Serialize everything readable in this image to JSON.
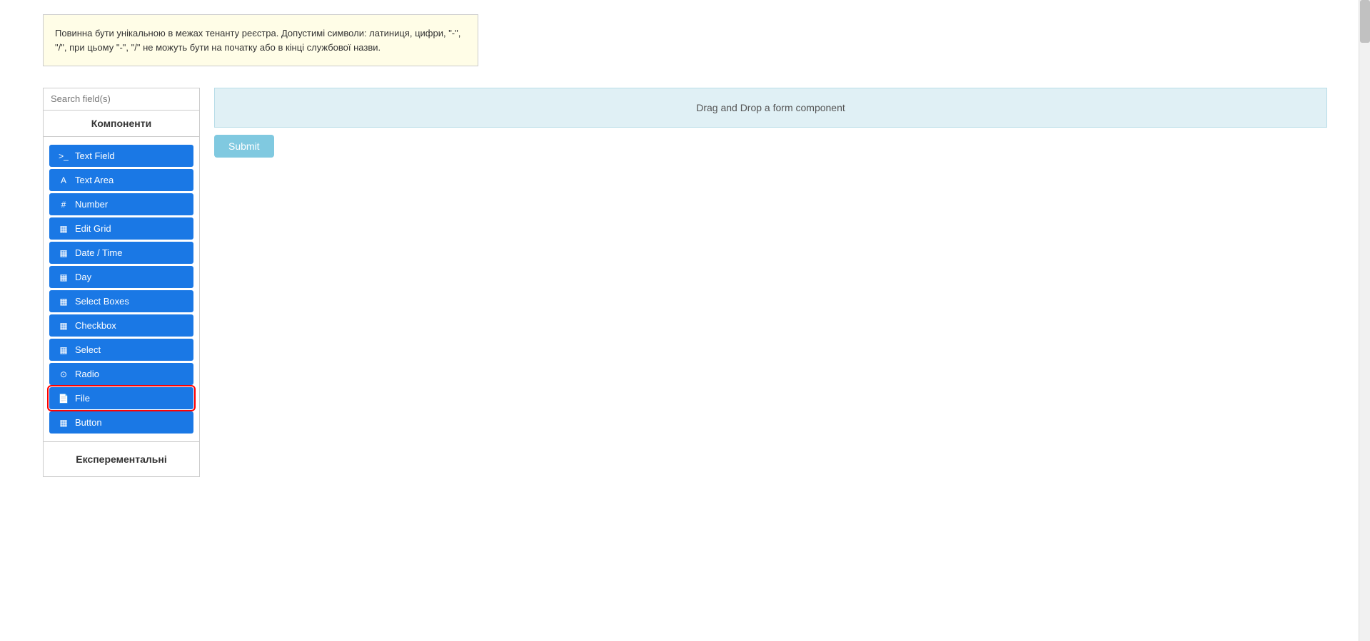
{
  "tooltip": {
    "text": "Повинна бути унікальною в межах тенанту реєстра. Допустимі символи: латиниця, цифри, \"-\", \"/\", при цьому \"-\", \"/\" не можуть бути на початку або в кінці службової назви."
  },
  "sidebar": {
    "search_placeholder": "Search field(s)",
    "components_label": "Компоненти",
    "experimental_label": "Експерементальні",
    "items": [
      {
        "id": "text-field",
        "label": "Text Field",
        "icon": ">_"
      },
      {
        "id": "text-area",
        "label": "Text Area",
        "icon": "A"
      },
      {
        "id": "number",
        "label": "Number",
        "icon": "#"
      },
      {
        "id": "edit-grid",
        "label": "Edit Grid",
        "icon": "⊞"
      },
      {
        "id": "date-time",
        "label": "Date / Time",
        "icon": "📅"
      },
      {
        "id": "day",
        "label": "Day",
        "icon": "📅"
      },
      {
        "id": "select-boxes",
        "label": "Select Boxes",
        "icon": "⊞"
      },
      {
        "id": "checkbox",
        "label": "Checkbox",
        "icon": "⊞"
      },
      {
        "id": "select",
        "label": "Select",
        "icon": "⊞"
      },
      {
        "id": "radio",
        "label": "Radio",
        "icon": "⊙"
      },
      {
        "id": "file",
        "label": "File",
        "icon": "📄",
        "highlighted": true
      },
      {
        "id": "button",
        "label": "Button",
        "icon": "⊞"
      }
    ]
  },
  "form_builder": {
    "drag_drop_label": "Drag and Drop a form component",
    "submit_label": "Submit"
  }
}
